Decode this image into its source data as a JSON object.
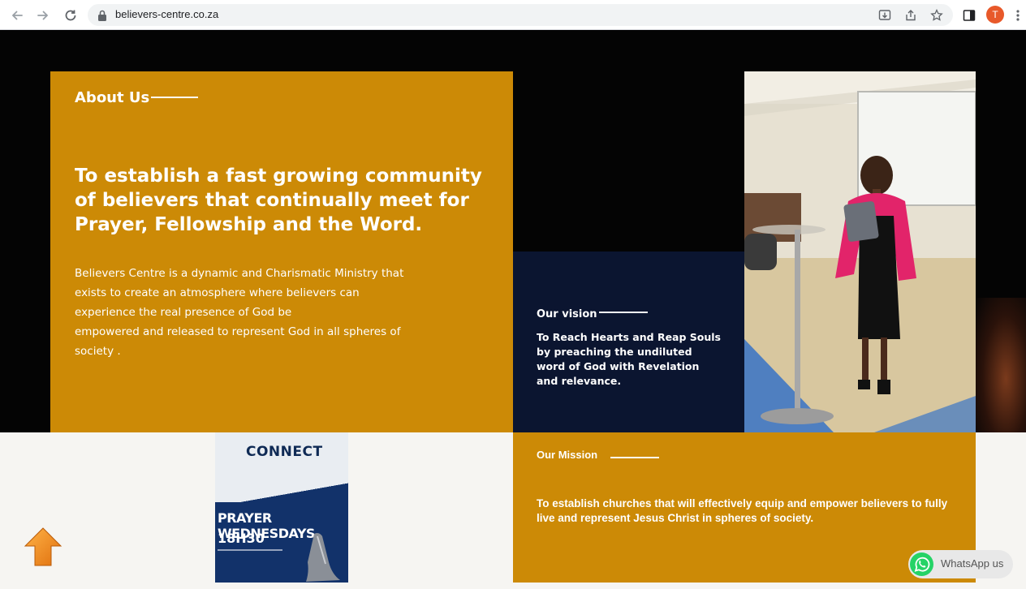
{
  "browser": {
    "url": "believers-centre.co.za",
    "profile_initial": "T",
    "icons": [
      "back-arrow-icon",
      "forward-arrow-icon",
      "reload-icon",
      "lock-icon",
      "install-app-icon",
      "share-icon",
      "bookmark-star-icon",
      "side-panel-icon",
      "kebab-menu-icon"
    ]
  },
  "about": {
    "title": "About Us",
    "headline": "To establish a fast growing community of believers that continually meet for Prayer, Fellowship and the Word.",
    "body_lines": [
      "Believers Centre is a dynamic and Charismatic Ministry that",
      "exists to create an atmosphere where believers can",
      "experience the real presence of God be",
      "empowered and released to represent God in all spheres of",
      "society ."
    ]
  },
  "vision": {
    "title": "Our vision",
    "text": "To Reach Hearts and Reap Souls by preaching the undiluted word of God with Revelation and relevance."
  },
  "mission": {
    "title": "Our Mission",
    "text": "To establish churches that will effectively equip and empower believers to fully live and represent Jesus Christ in spheres of society."
  },
  "poster": {
    "brand": "CONNECT",
    "title": "PRAYER WEDNESDAYS",
    "time": "18H30"
  },
  "whatsapp": {
    "label": "WhatsApp us"
  },
  "colors": {
    "gold": "#cc8a06",
    "navy": "#0b1530",
    "hero_bg": "#040404"
  }
}
